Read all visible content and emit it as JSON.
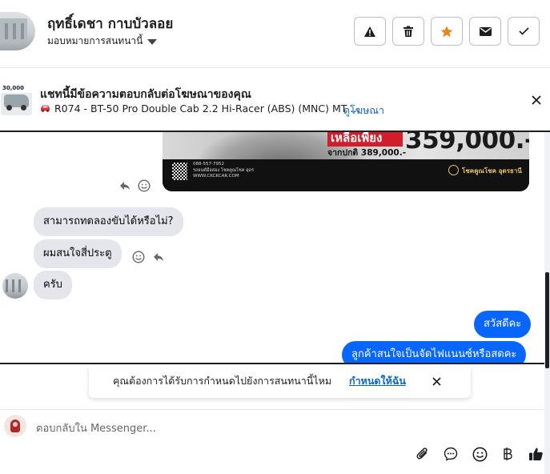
{
  "header": {
    "contact_name": "ฤทธิ์เดชา กาบบัวลอย",
    "assign_label": "มอบหมายการสนทนานี้",
    "actions": [
      {
        "name": "spam-warning",
        "icon": "warning-icon"
      },
      {
        "name": "delete",
        "icon": "trash-icon"
      },
      {
        "name": "star",
        "icon": "star-icon",
        "color": "#e8871e"
      },
      {
        "name": "mark-unread",
        "icon": "envelope-icon"
      },
      {
        "name": "mark-done",
        "icon": "check-icon"
      }
    ]
  },
  "ad_banner": {
    "thumb_text": "30,000",
    "title": "แชทนี้มีข้อความตอบกลับต่อโฆษณาของคุณ",
    "subtitle": "R074 - BT-50 Pro Double Cab 2.2 Hi-Racer (ABS) (MNC) MT ...",
    "link": "ดูโฆษณา"
  },
  "ad_image": {
    "tag": "เหลือเพียง",
    "price": "359,000.-",
    "was": "จากปกติ 389,000.-",
    "phone": "088-557-7952",
    "facebook": "รถยนต์มือสอง โชคคูณโชค อุดร",
    "website": "WWW.CKCKCAR.COM",
    "dealer": "โชคคูณโชค อุดรธานี"
  },
  "messages": [
    {
      "from": "contact",
      "text": "สามารถทดลองขับได้หรือไม่?"
    },
    {
      "from": "contact",
      "text": "ผมสนใจสี่ประตู"
    },
    {
      "from": "contact",
      "text": "ครับ"
    },
    {
      "from": "me",
      "text": "สวัสดีคะ"
    },
    {
      "from": "me",
      "text": "ลูกค้าสนใจเป็นจัดไฟแนนซ์หรือสดคะ"
    }
  ],
  "notice": {
    "text": "คุณต้องการได้รับการกำหนดไปยังการสนทนานี้ไหม",
    "link": "กำหนดให้ฉัน"
  },
  "composer": {
    "placeholder": "ตอบกลับใน Messenger...",
    "tools": [
      "paperclip-icon",
      "chat-bubble-icon",
      "emoji-icon",
      "baht-icon",
      "thumbs-up-icon"
    ]
  },
  "colors": {
    "accent": "#0866ff",
    "incoming_bubble": "#e4e6eb",
    "link": "#0a66c2",
    "star": "#e8871e"
  }
}
